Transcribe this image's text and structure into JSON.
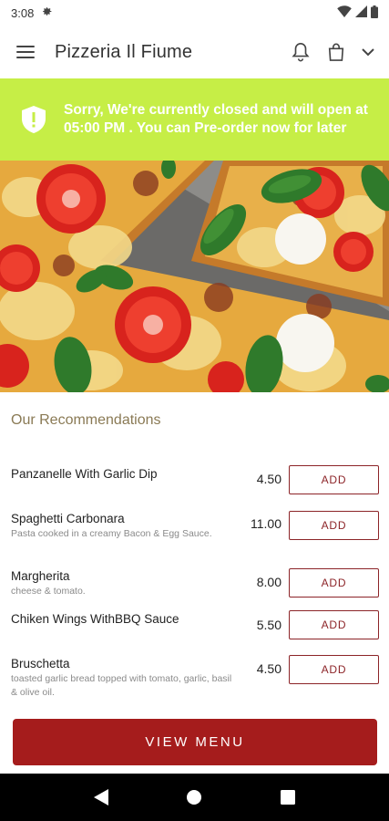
{
  "status_bar": {
    "time": "3:08"
  },
  "app_bar": {
    "title": "Pizzeria Il Fiume"
  },
  "banner": {
    "message": "Sorry, We're currently closed and will open at 05:00 PM . You can Pre-order now for later"
  },
  "recommendations": {
    "title": "Our Recommendations",
    "items": [
      {
        "name": "Panzanelle With Garlic Dip",
        "description": "",
        "price": "4.50",
        "add_label": "ADD"
      },
      {
        "name": "Spaghetti Carbonara",
        "description": "Pasta cooked in a creamy Bacon & Egg Sauce.",
        "price": "11.00",
        "add_label": "ADD"
      },
      {
        "name": "Margherita",
        "description": "cheese & tomato.",
        "price": "8.00",
        "add_label": "ADD"
      },
      {
        "name": "Chiken Wings WithBBQ Sauce",
        "description": "",
        "price": "5.50",
        "add_label": "ADD"
      },
      {
        "name": "Bruschetta",
        "description": "toasted garlic bread topped with tomato, garlic, basil & olive oil.",
        "price": "4.50",
        "add_label": "ADD"
      }
    ]
  },
  "view_menu_label": "VIEW MENU",
  "colors": {
    "banner": "#c6ee46",
    "brand": "#a51c1c",
    "section_title": "#8a7a55"
  },
  "icons": [
    "gear-icon",
    "wifi-icon",
    "signal-icon",
    "battery-icon",
    "hamburger-menu-icon",
    "bell-icon",
    "shopping-bag-icon",
    "chevron-down-icon",
    "shield-alert-icon",
    "back-icon",
    "home-icon",
    "recents-icon"
  ]
}
